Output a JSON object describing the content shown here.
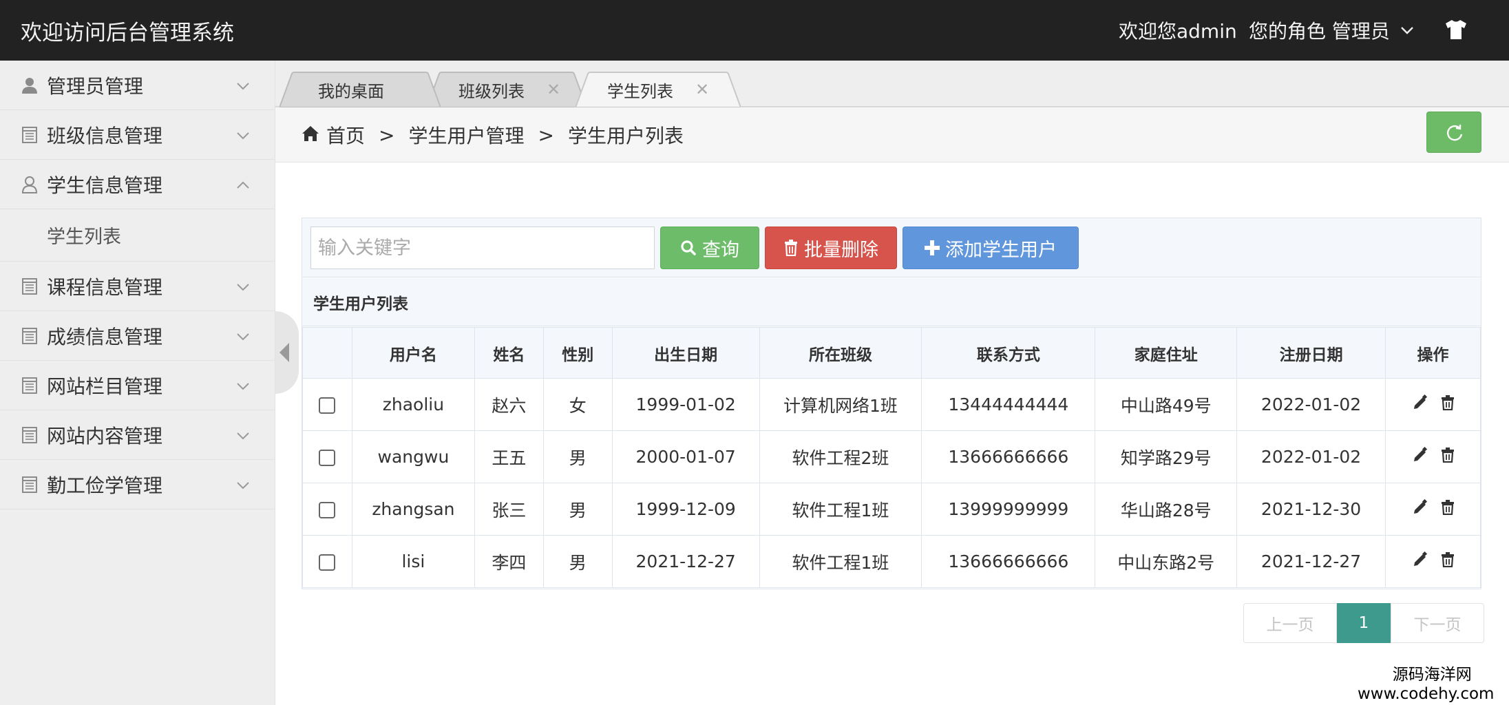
{
  "header": {
    "title": "欢迎访问后台管理系统",
    "welcome": "欢迎您admin",
    "role": "您的角色  管理员",
    "theme_icon": "tshirt-icon"
  },
  "sidebar": {
    "items": [
      {
        "label": "管理员管理",
        "icon": "admin-user-icon",
        "expanded": false
      },
      {
        "label": "班级信息管理",
        "icon": "document-icon",
        "expanded": false
      },
      {
        "label": "学生信息管理",
        "icon": "student-user-icon",
        "expanded": true,
        "sub": [
          {
            "label": "学生列表"
          }
        ]
      },
      {
        "label": "课程信息管理",
        "icon": "document-icon",
        "expanded": false
      },
      {
        "label": "成绩信息管理",
        "icon": "document-icon",
        "expanded": false
      },
      {
        "label": "网站栏目管理",
        "icon": "document-icon",
        "expanded": false
      },
      {
        "label": "网站内容管理",
        "icon": "document-icon",
        "expanded": false
      },
      {
        "label": "勤工俭学管理",
        "icon": "document-icon",
        "expanded": false
      }
    ]
  },
  "tabs": [
    {
      "label": "我的桌面",
      "active": false,
      "closable": false
    },
    {
      "label": "班级列表",
      "active": false,
      "closable": true
    },
    {
      "label": "学生列表",
      "active": true,
      "closable": true
    }
  ],
  "close_glyph": "✕",
  "breadcrumb": {
    "items": [
      "首页",
      "学生用户管理",
      "学生用户列表"
    ],
    "separator": ">"
  },
  "toolbar": {
    "search_placeholder": "输入关键字",
    "query_label": "查询",
    "batch_delete_label": "批量删除",
    "add_label": "添加学生用户"
  },
  "list": {
    "caption": "学生用户列表",
    "columns": [
      "",
      "用户名",
      "姓名",
      "性别",
      "出生日期",
      "所在班级",
      "联系方式",
      "家庭住址",
      "注册日期",
      "操作"
    ],
    "rows": [
      {
        "username": "zhaoliu",
        "name": "赵六",
        "gender": "女",
        "birth": "1999-01-02",
        "class": "计算机网络1班",
        "phone": "13444444444",
        "address": "中山路49号",
        "registered": "2022-01-02"
      },
      {
        "username": "wangwu",
        "name": "王五",
        "gender": "男",
        "birth": "2000-01-07",
        "class": "软件工程2班",
        "phone": "13666666666",
        "address": "知学路29号",
        "registered": "2022-01-02"
      },
      {
        "username": "zhangsan",
        "name": "张三",
        "gender": "男",
        "birth": "1999-12-09",
        "class": "软件工程1班",
        "phone": "13999999999",
        "address": "华山路28号",
        "registered": "2021-12-30"
      },
      {
        "username": "lisi",
        "name": "李四",
        "gender": "男",
        "birth": "2021-12-27",
        "class": "软件工程1班",
        "phone": "13666666666",
        "address": "中山东路2号",
        "registered": "2021-12-27"
      }
    ]
  },
  "pagination": {
    "prev": "上一页",
    "current": "1",
    "next": "下一页"
  },
  "watermark": {
    "line1": "源码海洋网",
    "line2": "www.codehy.com"
  },
  "colors": {
    "header_bg": "#222222",
    "query_green": "#6cbc69",
    "delete_red": "#d7544d",
    "add_blue": "#6096dc",
    "page_active": "#3d9a8c"
  }
}
